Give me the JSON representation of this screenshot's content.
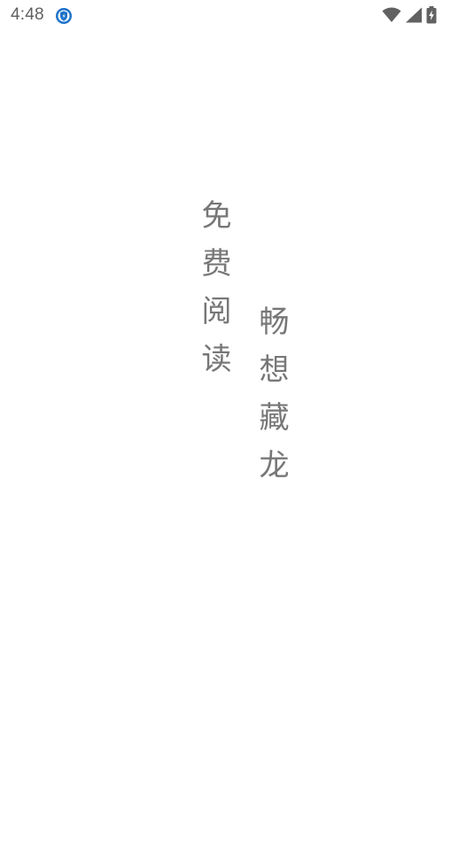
{
  "status_bar": {
    "time": "4:48",
    "app_icon": "shield-app-icon",
    "icons": [
      "wifi-icon",
      "cellular-signal-icon",
      "battery-charging-icon"
    ],
    "text_color": "#5f5f5f",
    "app_icon_color": "#1e73c8"
  },
  "splash": {
    "column_left": "免费阅读",
    "column_right": "畅想藏龙",
    "text_color": "#777777",
    "background": "#ffffff"
  }
}
